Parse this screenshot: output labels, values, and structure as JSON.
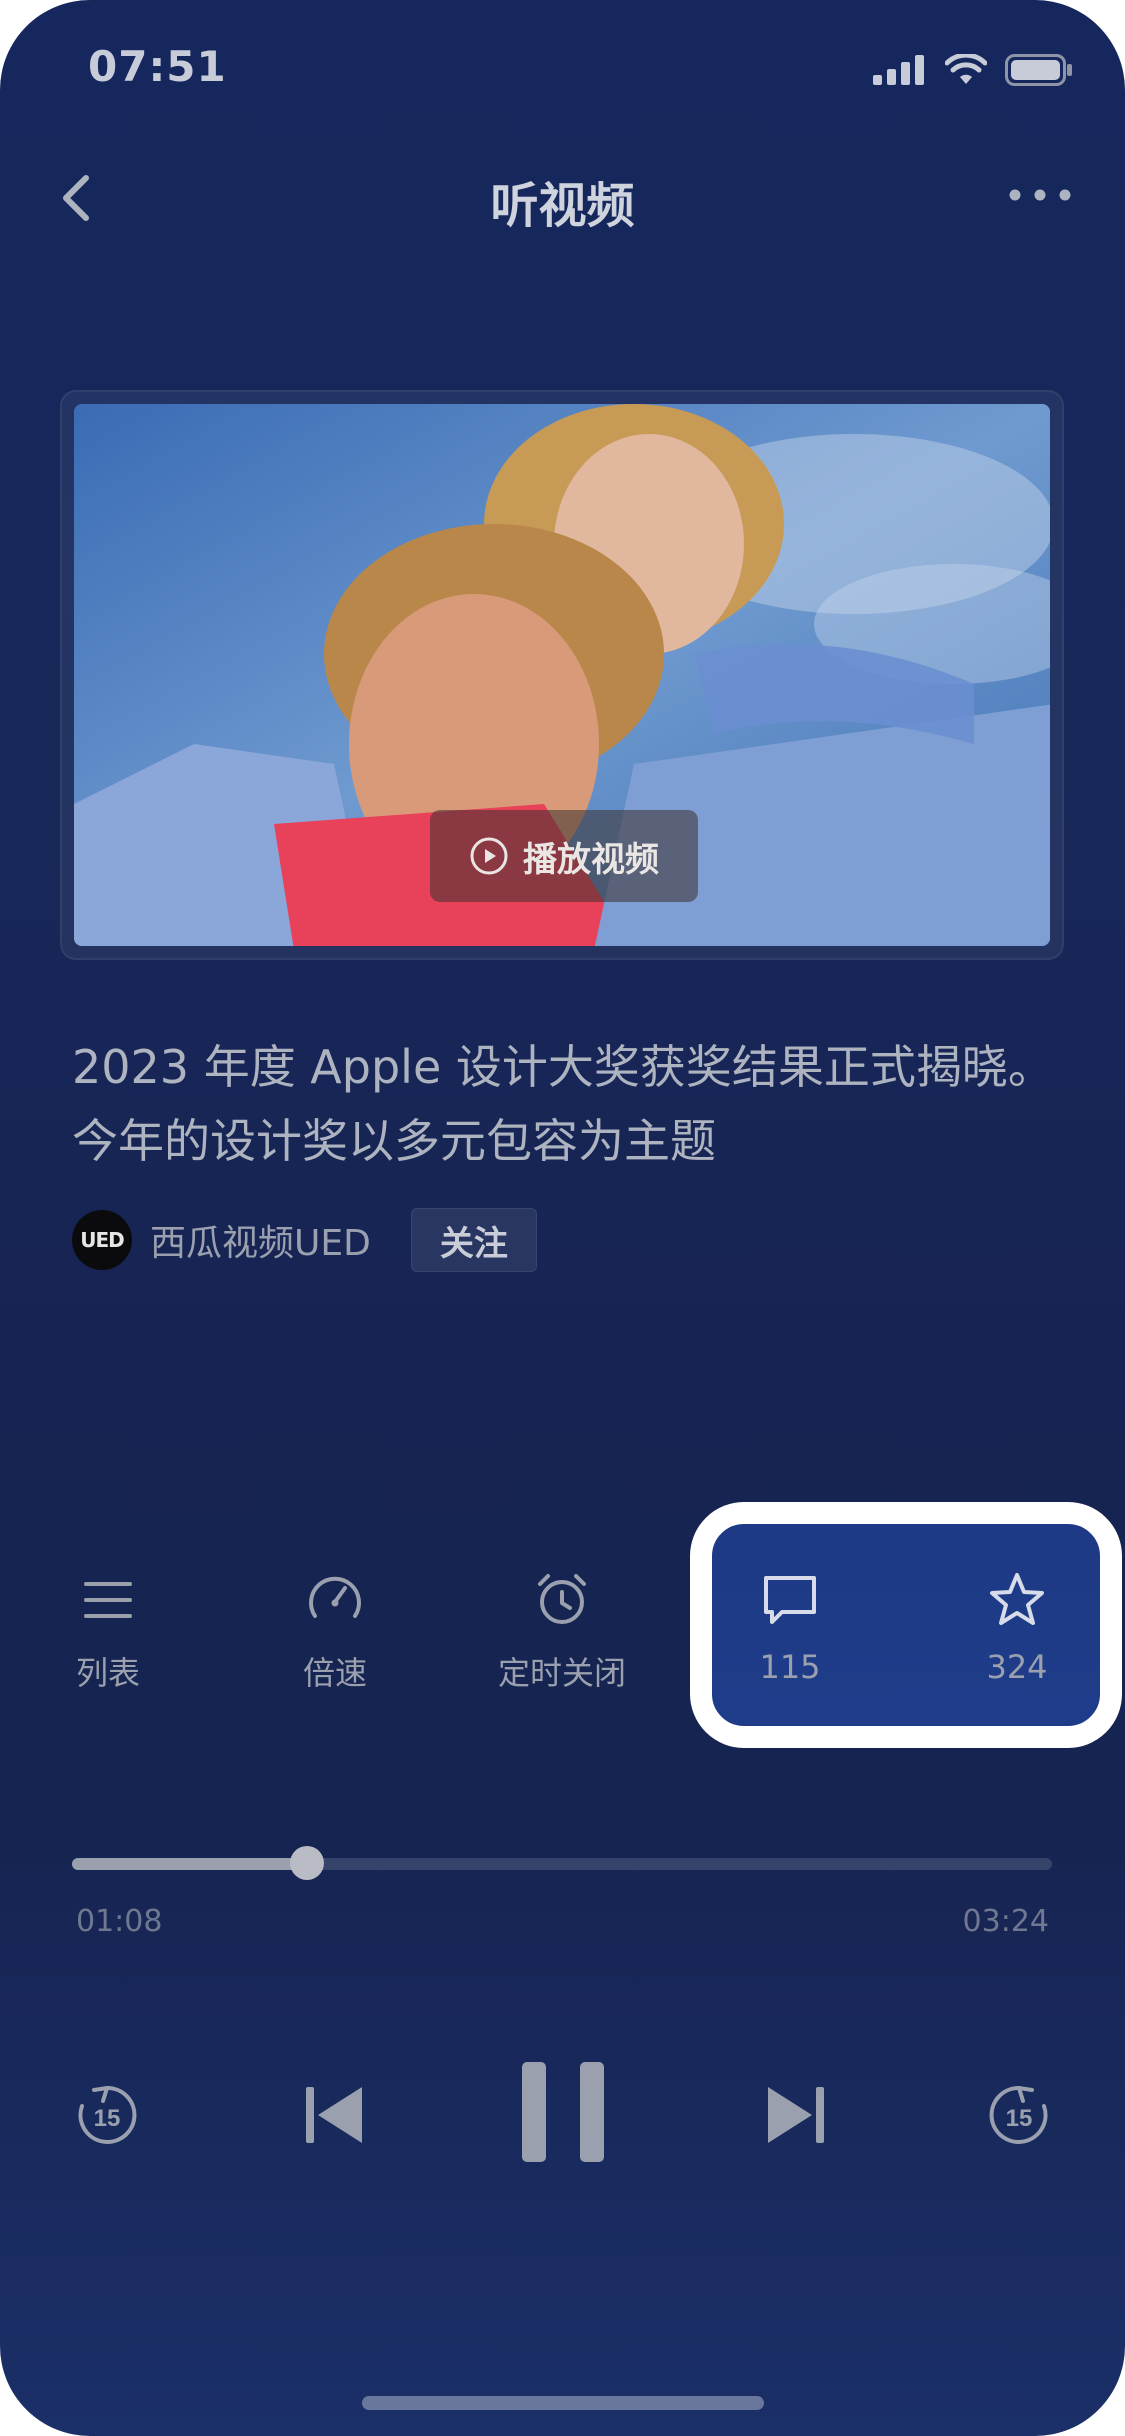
{
  "status_bar": {
    "time": "07:51"
  },
  "nav": {
    "title": "听视频"
  },
  "video": {
    "play_label": "播放视频"
  },
  "content": {
    "title": "2023 年度 Apple 设计大奖获奖结果正式揭晓。今年的设计奖以多元包容为主题",
    "author": "西瓜视频UED",
    "avatar_text": "UED",
    "follow_label": "关注"
  },
  "actions": {
    "list_label": "列表",
    "speed_label": "倍速",
    "timer_label": "定时关闭",
    "comments_count": "115",
    "favorites_count": "324"
  },
  "player": {
    "current_time": "01:08",
    "total_time": "03:24",
    "progress": 0.24,
    "rewind_seconds": "15",
    "forward_seconds": "15"
  },
  "colors": {
    "background": "#172859",
    "highlight": "#1e3a86",
    "text_secondary": "#9aa0ae"
  }
}
